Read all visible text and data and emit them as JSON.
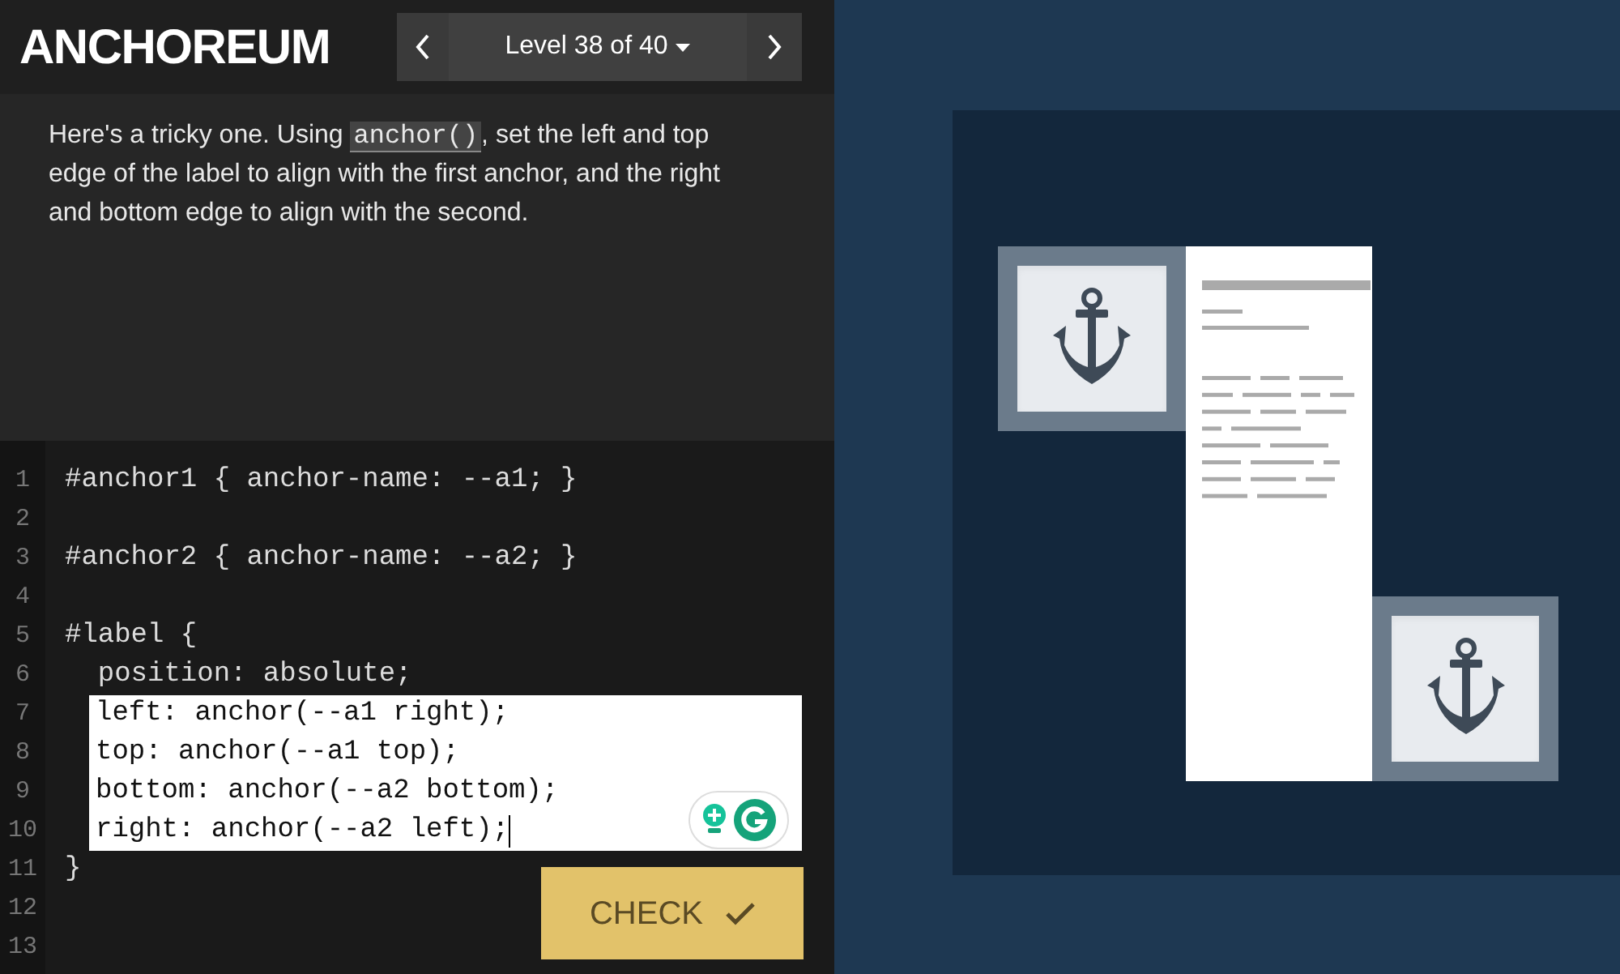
{
  "header": {
    "logo": "ANCHOREUM",
    "level_label": "Level 38 of 40"
  },
  "instructions": {
    "before": "Here's a tricky one. Using ",
    "code": "anchor()",
    "after": ", set the left and top edge of the label to align with the first anchor, and the right and bottom edge to align with the second."
  },
  "editor": {
    "lines": [
      {
        "number": "1",
        "text": "#anchor1 { anchor-name: --a1; }",
        "editable": false,
        "cursor": false
      },
      {
        "number": "2",
        "editable": false,
        "cursor": false
      },
      {
        "number": "3",
        "text": "#anchor2 { anchor-name: --a2; }",
        "editable": false,
        "cursor": false
      },
      {
        "number": "4",
        "editable": false,
        "cursor": false
      },
      {
        "number": "5",
        "text": "#label {",
        "editable": false,
        "cursor": false
      },
      {
        "number": "6",
        "text": "  position: absolute;",
        "editable": false,
        "cursor": false
      },
      {
        "number": "7",
        "text": "left: anchor(--a1 right);",
        "editable": true,
        "cursor": false
      },
      {
        "number": "8",
        "text": "top: anchor(--a1 top);",
        "editable": true,
        "cursor": false
      },
      {
        "number": "9",
        "text": "bottom: anchor(--a2 bottom);",
        "editable": true,
        "cursor": false
      },
      {
        "number": "10",
        "text": "right: anchor(--a2 left);",
        "editable": true,
        "cursor": true
      },
      {
        "number": "11",
        "text": "}",
        "editable": false,
        "cursor": false
      },
      {
        "number": "12",
        "editable": false,
        "cursor": false
      },
      {
        "number": "13",
        "editable": false,
        "cursor": false
      }
    ],
    "check_button": "CHECK"
  }
}
